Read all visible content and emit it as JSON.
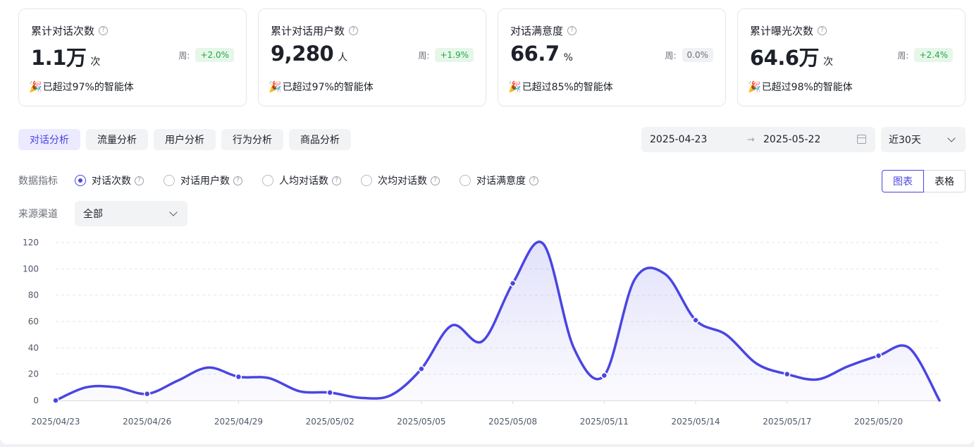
{
  "stats": [
    {
      "title": "累计对话次数",
      "value": "1.1万",
      "unit": "次",
      "week_label": "周:",
      "change": "+2.0%",
      "trend": "up",
      "note": "已超过97%的智能体",
      "note_icon": "party-popper-icon"
    },
    {
      "title": "累计对话用户数",
      "value": "9,280",
      "unit": "人",
      "week_label": "周:",
      "change": "+1.9%",
      "trend": "up",
      "note": "已超过97%的智能体",
      "note_icon": "party-popper-icon"
    },
    {
      "title": "对话满意度",
      "value": "66.7",
      "unit": "%",
      "week_label": "周:",
      "change": "0.0%",
      "trend": "flat",
      "note": "已超过85%的智能体",
      "note_icon": "party-popper-icon"
    },
    {
      "title": "累计曝光次数",
      "value": "64.6万",
      "unit": "次",
      "week_label": "周:",
      "change": "+2.4%",
      "trend": "up",
      "note": "已超过98%的智能体",
      "note_icon": "party-popper-icon"
    }
  ],
  "tabs": [
    {
      "label": "对话分析",
      "active": true
    },
    {
      "label": "流量分析",
      "active": false
    },
    {
      "label": "用户分析",
      "active": false
    },
    {
      "label": "行为分析",
      "active": false
    },
    {
      "label": "商品分析",
      "active": false
    }
  ],
  "date_range": {
    "start": "2025-04-23",
    "arrow": "→",
    "end": "2025-05-22"
  },
  "period": {
    "value": "近30天"
  },
  "metrics": {
    "label": "数据指标",
    "options": [
      {
        "label": "对话次数",
        "selected": true
      },
      {
        "label": "对话用户数",
        "selected": false
      },
      {
        "label": "人均对话数",
        "selected": false
      },
      {
        "label": "次均对话数",
        "selected": false
      },
      {
        "label": "对话满意度",
        "selected": false
      }
    ]
  },
  "view_toggle": {
    "chart_label": "图表",
    "table_label": "表格",
    "active": "chart"
  },
  "channel": {
    "label": "来源渠道",
    "value": "全部"
  },
  "colors": {
    "accent": "#4b45e0",
    "trend_up": "#22a845",
    "line": "#4a45e2"
  },
  "chart_data": {
    "type": "area",
    "title": "",
    "xlabel": "",
    "ylabel": "",
    "ylim": [
      0,
      120
    ],
    "y_ticks": [
      0,
      20,
      40,
      60,
      80,
      100,
      120
    ],
    "grid": true,
    "x_tick_labels": [
      "2025/04/23",
      "2025/04/26",
      "2025/04/29",
      "2025/05/02",
      "2025/05/05",
      "2025/05/08",
      "2025/05/11",
      "2025/05/14",
      "2025/05/17",
      "2025/05/20"
    ],
    "x": [
      "2025/04/23",
      "2025/04/24",
      "2025/04/25",
      "2025/04/26",
      "2025/04/27",
      "2025/04/28",
      "2025/04/29",
      "2025/04/30",
      "2025/05/01",
      "2025/05/02",
      "2025/05/03",
      "2025/05/04",
      "2025/05/05",
      "2025/05/06",
      "2025/05/07",
      "2025/05/08",
      "2025/05/09",
      "2025/05/10",
      "2025/05/11",
      "2025/05/12",
      "2025/05/13",
      "2025/05/14",
      "2025/05/15",
      "2025/05/16",
      "2025/05/17",
      "2025/05/18",
      "2025/05/19",
      "2025/05/20",
      "2025/05/21",
      "2025/05/22"
    ],
    "series": [
      {
        "values": [
          0,
          10,
          10,
          5,
          15,
          25,
          18,
          17,
          7,
          6,
          2,
          4,
          24,
          57,
          45,
          89,
          119,
          40,
          19,
          92,
          96,
          61,
          50,
          28,
          20,
          16,
          26,
          34,
          40,
          0
        ]
      }
    ],
    "markers": [
      0,
      3,
      6,
      9,
      12,
      15,
      18,
      21,
      24,
      27
    ]
  }
}
